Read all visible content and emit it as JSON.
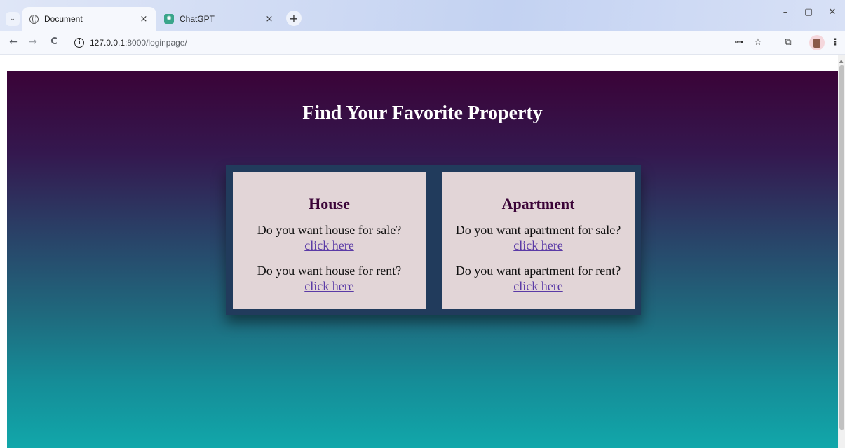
{
  "browser": {
    "tabs": [
      {
        "label": "Document",
        "icon": "globe-icon",
        "active": true
      },
      {
        "label": "ChatGPT",
        "icon": "chatgpt-icon",
        "active": false
      }
    ],
    "new_tab_label": "+",
    "tab_close_glyph": "×",
    "window_controls": {
      "minimize": "–",
      "restore": "▢",
      "close": "✕"
    },
    "nav": {
      "back": "←",
      "forward": "→",
      "reload": "C"
    },
    "url_host": "127.0.0.1",
    "url_path": ":8000/loginpage/",
    "toolbar_icons": {
      "password": "⊶",
      "bookmark": "☆",
      "extensions": "⧉",
      "menu": "⋮"
    }
  },
  "page": {
    "title": "Find Your Favorite Property",
    "background_colors": [
      "#3a0337",
      "#11a7aa"
    ],
    "cards": [
      {
        "heading": "House",
        "sale_question": "Do you want house for sale?",
        "sale_link": "click here",
        "rent_question": "Do you want house for rent?",
        "rent_link": "click here"
      },
      {
        "heading": "Apartment",
        "sale_question": "Do you want apartment for sale?",
        "sale_link": "click here",
        "rent_question": "Do you want apartment for rent?",
        "rent_link": "click here"
      }
    ]
  }
}
